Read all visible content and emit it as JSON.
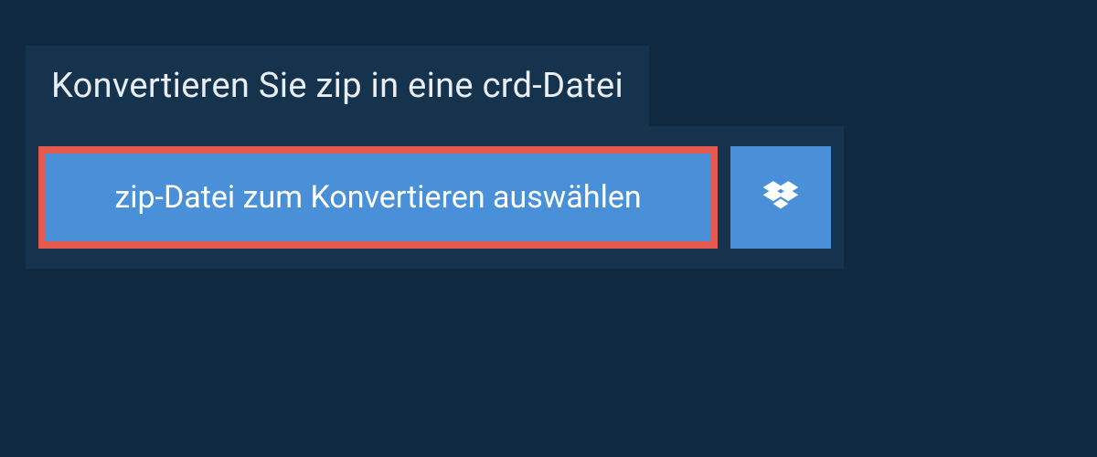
{
  "title": "Konvertieren Sie zip in eine crd-Datei",
  "selectButton": {
    "label": "zip-Datei zum Konvertieren auswählen"
  },
  "colors": {
    "background": "#0f2940",
    "panel": "#16334d",
    "button": "#4a90d9",
    "highlight": "#e45a4f"
  }
}
